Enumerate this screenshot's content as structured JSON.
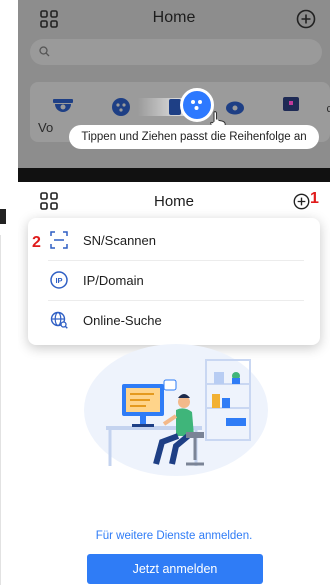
{
  "top_screenshot": {
    "header": {
      "title": "Home",
      "apps_icon": "grid-icon",
      "add_icon": "plus-circle-icon"
    },
    "search": {
      "icon": "search-icon"
    },
    "card": {
      "left_label": "Vo",
      "right_label": "c"
    },
    "tooltip": "Tippen und Ziehen passt die Reihenfolge an"
  },
  "bottom_screenshot": {
    "header": {
      "title": "Home",
      "apps_icon": "grid-icon",
      "add_icon": "plus-circle-icon",
      "annotation": "1"
    },
    "menu": {
      "annotation": "2",
      "items": [
        {
          "label": "SN/Scannen",
          "icon": "scan-icon"
        },
        {
          "label": "IP/Domain",
          "icon": "ip-icon"
        },
        {
          "label": "Online-Suche",
          "icon": "globe-search-icon"
        }
      ]
    },
    "prompt": "Für weitere Dienste anmelden.",
    "login_button": "Jetzt anmelden"
  },
  "colors": {
    "accent": "#2f7cf6",
    "annotation_red": "#e01b1b",
    "dim_overlay": "#8d8d8d"
  }
}
